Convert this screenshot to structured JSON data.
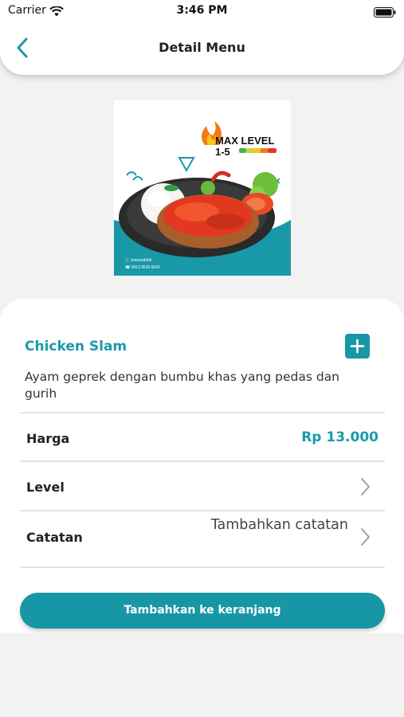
{
  "status_bar": {
    "carrier": "Carrier",
    "time": "3:46 PM"
  },
  "header": {
    "title": "Detail Menu",
    "back_icon": "chevron-left-icon"
  },
  "image": {
    "badge_title": "MAX LEVEL",
    "badge_range": "1-5",
    "footer_line1": "ⓘ Jowarodebil",
    "footer_line2": "☎ 0813 0630 6042"
  },
  "item": {
    "name": "Chicken Slam",
    "description": "Ayam geprek dengan bumbu khas yang pedas dan gurih",
    "add_icon": "plus-icon"
  },
  "rows": {
    "price_label": "Harga",
    "price_value": "Rp 13.000",
    "level_label": "Level",
    "note_label": "Catatan",
    "note_value": "Tambahkan catatan"
  },
  "cart_button": {
    "label": "Tambahkan ke keranjang"
  },
  "colors": {
    "accent": "#1797a6",
    "accent_text": "#1a9aab",
    "background": "#f2f2f2"
  }
}
